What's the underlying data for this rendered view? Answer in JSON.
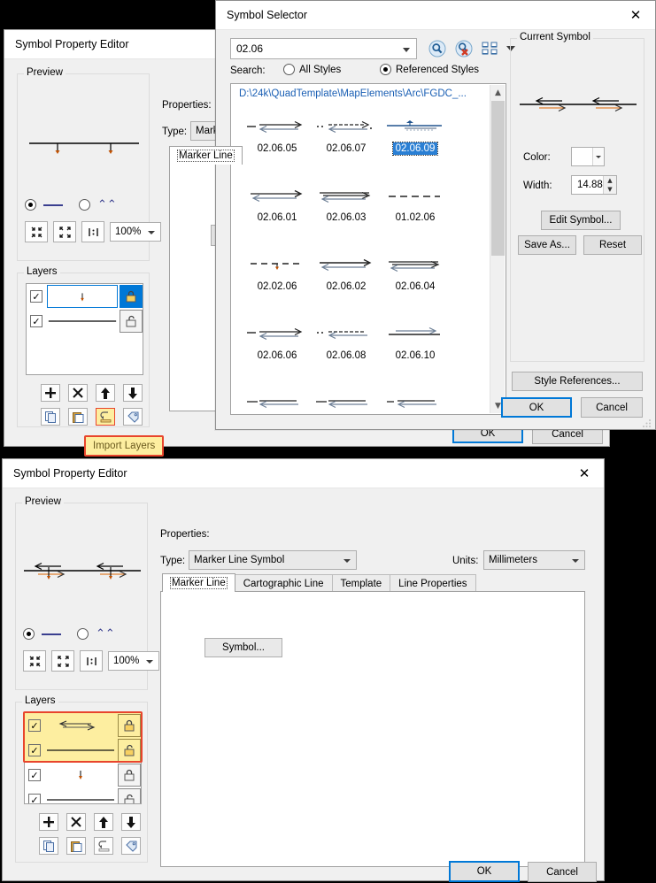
{
  "windows": {
    "editor_top": {
      "title": "Symbol Property Editor",
      "preview_legend": "Preview",
      "zoom_value": "100%",
      "layers_legend": "Layers",
      "properties_label": "Properties:",
      "type_label": "Type:",
      "type_value": "Marker Line Symbol",
      "tab_active": "Marker Line",
      "ok_label": "OK",
      "cancel_label": "Cancel",
      "tooltip": "Import Layers",
      "layer_rows": [
        {
          "checked": "✓",
          "glyph": "marker-line-dot",
          "lock": "locked"
        },
        {
          "checked": "✓",
          "glyph": "solid-line",
          "lock": "unlocked"
        }
      ],
      "layer_tools": [
        "add-layer",
        "delete-layer",
        "move-up",
        "move-down",
        "copy-layer",
        "paste-layer",
        "import-layers",
        "tag-layer"
      ]
    },
    "symbol_selector": {
      "title": "Symbol Selector",
      "close_icon": "✕",
      "search_value": "02.06",
      "search_label": "Search:",
      "radio_all_styles": "All Styles",
      "radio_referenced_styles": "Referenced Styles",
      "selected_search_scope": "Referenced Styles",
      "toolbar_icons": [
        "search-icon",
        "clear-search-icon",
        "view-mode-icon",
        "view-mode-dropdown-icon"
      ],
      "path": "D:\\24k\\QuadTemplate\\MapElements\\Arc\\FGDC_...",
      "symbols": [
        {
          "name": "02.06.05",
          "glyph": "dash-double-arrow",
          "selected": false
        },
        {
          "name": "02.06.07",
          "glyph": "dotdash-double-arrow",
          "selected": false
        },
        {
          "name": "02.06.09",
          "glyph": "line-arrow-hatch",
          "selected": true
        },
        {
          "name": "02.06.01",
          "glyph": "double-arrow-right",
          "selected": false
        },
        {
          "name": "02.06.03",
          "glyph": "double-arrow-left",
          "selected": false
        },
        {
          "name": "01.02.06",
          "glyph": "dashed-line",
          "selected": false
        },
        {
          "name": "02.02.06",
          "glyph": "dashed-dot-line",
          "selected": false
        },
        {
          "name": "02.06.02",
          "glyph": "double-arrow-right",
          "selected": false
        },
        {
          "name": "02.06.04",
          "glyph": "double-arrow-left",
          "selected": false
        },
        {
          "name": "02.06.06",
          "glyph": "dash-double-arrow",
          "selected": false
        },
        {
          "name": "02.06.08",
          "glyph": "dotdash-double-arrow",
          "selected": false
        },
        {
          "name": "02.06.10",
          "glyph": "line-single-arrow",
          "selected": false
        }
      ],
      "current_symbol_legend": "Current Symbol",
      "color_label": "Color:",
      "color_value": "#000000",
      "width_label": "Width:",
      "width_value": "14.88",
      "edit_symbol_label": "Edit Symbol...",
      "save_as_label": "Save As...",
      "reset_label": "Reset",
      "style_references_label": "Style References...",
      "ok_label": "OK",
      "cancel_label": "Cancel"
    },
    "editor_bottom": {
      "title": "Symbol Property Editor",
      "close_icon": "✕",
      "preview_legend": "Preview",
      "zoom_value": "100%",
      "layers_legend": "Layers",
      "properties_label": "Properties:",
      "type_label": "Type:",
      "type_value": "Marker Line Symbol",
      "units_label": "Units:",
      "units_value": "Millimeters",
      "tabs": [
        "Marker Line",
        "Cartographic Line",
        "Template",
        "Line Properties"
      ],
      "active_tab": "Marker Line",
      "symbol_button_label": "Symbol...",
      "ok_label": "OK",
      "cancel_label": "Cancel",
      "layer_rows": [
        {
          "checked": "✓",
          "glyph": "double-arrow-left",
          "lock": "locked",
          "highlighted": true
        },
        {
          "checked": "✓",
          "glyph": "solid-line",
          "lock": "unlocked",
          "highlighted": true
        },
        {
          "checked": "✓",
          "glyph": "marker-line-dot",
          "lock": "locked",
          "highlighted": false
        },
        {
          "checked": "✓",
          "glyph": "solid-line",
          "lock": "unlocked",
          "highlighted": false
        }
      ],
      "layer_tools": [
        "add-layer",
        "delete-layer",
        "move-up",
        "move-down",
        "copy-layer",
        "paste-layer",
        "import-layers",
        "tag-layer"
      ]
    }
  },
  "colors": {
    "accent": "#0078d7",
    "highlight_yellow": "#fdeea0",
    "highlight_border": "#e8452c",
    "link_blue": "#1a5fb4",
    "selection_blue": "#2a7fd4"
  }
}
